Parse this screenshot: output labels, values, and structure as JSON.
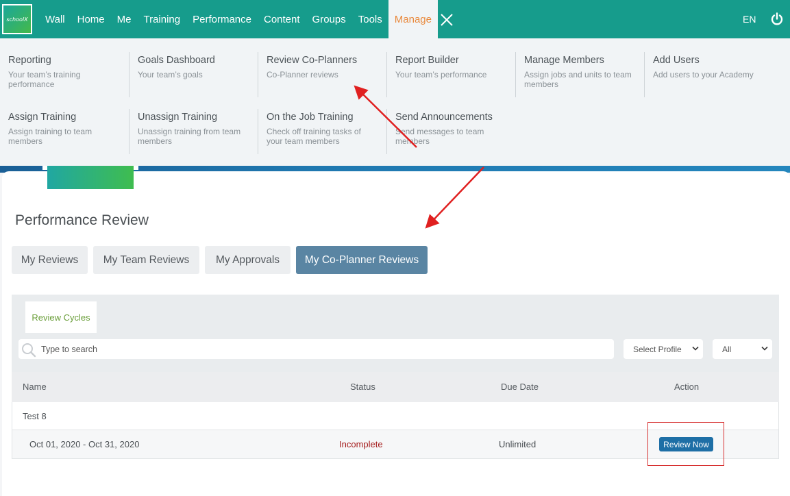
{
  "nav": {
    "logo_text": "schoolX",
    "items": [
      "Wall",
      "Home",
      "Me",
      "Training",
      "Performance",
      "Content",
      "Groups",
      "Tools",
      "Manage"
    ],
    "active": "Manage",
    "lang": "EN"
  },
  "manage_menu": {
    "row1": [
      {
        "title": "Reporting",
        "desc": "Your team’s training performance"
      },
      {
        "title": "Goals Dashboard",
        "desc": "Your team’s goals"
      },
      {
        "title": "Review Co-Planners",
        "desc": "Co-Planner reviews"
      },
      {
        "title": "Report Builder",
        "desc": "Your team’s performance"
      },
      {
        "title": "Manage Members",
        "desc": "Assign jobs and units to team members"
      },
      {
        "title": "Add Users",
        "desc": "Add users to your Academy"
      }
    ],
    "row2": [
      {
        "title": "Assign Training",
        "desc": "Assign training to team members"
      },
      {
        "title": "Unassign Training",
        "desc": "Unassign training from team members"
      },
      {
        "title": "On the Job Training",
        "desc": "Check off training tasks of your team members"
      },
      {
        "title": "Send Announcements",
        "desc": "Send messages to team members"
      }
    ]
  },
  "page": {
    "title": "Performance Review",
    "tabs": [
      "My Reviews",
      "My Team Reviews",
      "My Approvals",
      "My Co-Planner Reviews"
    ],
    "active_tab": "My Co-Planner Reviews",
    "sub_tab": "Review Cycles"
  },
  "filters": {
    "search_placeholder": "Type to search",
    "profile": "Select Profile",
    "status": "All"
  },
  "table": {
    "columns": [
      "Name",
      "Status",
      "Due Date",
      "Action"
    ],
    "group": "Test 8",
    "row": {
      "cycle": "Oct 01, 2020 - Oct 31, 2020",
      "status": "Incomplete",
      "due": "Unlimited",
      "action": "Review Now"
    }
  },
  "colors": {
    "nav_bg": "#169c8c",
    "active_nav_text": "#e98a3e",
    "active_tab_bg": "#5a85a3",
    "status_incomplete": "#a51d1d",
    "action_button": "#1e6fa6",
    "annotation": "#e02020"
  }
}
